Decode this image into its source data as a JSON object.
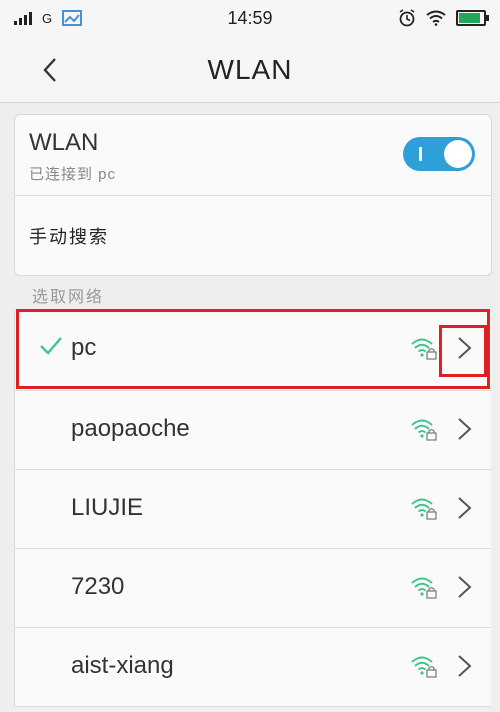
{
  "status_bar": {
    "carrier": "G",
    "time": "14:59",
    "icons": [
      "signal-icon",
      "gallery-icon",
      "alarm-icon",
      "wifi-icon",
      "battery-icon"
    ]
  },
  "header": {
    "title": "WLAN",
    "back_icon": "chevron-left-icon"
  },
  "wlan": {
    "label": "WLAN",
    "status": "已连接到 pc",
    "enabled": true
  },
  "manual_search": {
    "label": "手动搜索"
  },
  "section": {
    "label": "选取网络"
  },
  "networks": [
    {
      "name": "pc",
      "connected": true
    },
    {
      "name": "paopaoche",
      "connected": false
    },
    {
      "name": "LIUJIE",
      "connected": false
    },
    {
      "name": "7230",
      "connected": false
    },
    {
      "name": "aist-xiang",
      "connected": false
    }
  ],
  "colors": {
    "accent": "#2e9fd8",
    "wifi_signal": "#3ec58e",
    "highlight": "#e02020"
  }
}
